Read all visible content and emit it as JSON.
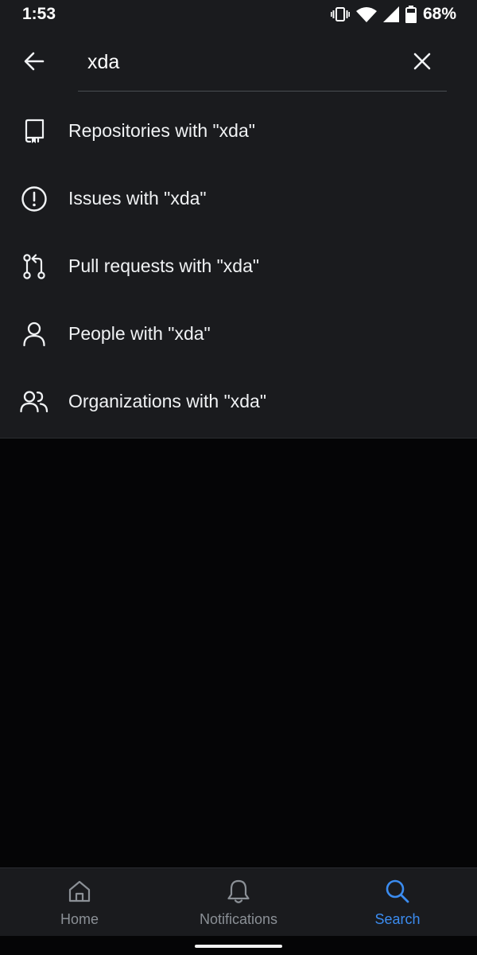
{
  "status_bar": {
    "time": "1:53",
    "battery_percent": "68%",
    "icons": [
      "vibrate-icon",
      "wifi-icon",
      "signal-icon",
      "battery-icon"
    ]
  },
  "search": {
    "query": "xda",
    "back_icon": "arrow-left-icon",
    "clear_icon": "close-icon"
  },
  "suggestions": [
    {
      "label": "Repositories with \"xda\"",
      "icon": "repo-icon"
    },
    {
      "label": "Issues with \"xda\"",
      "icon": "issue-opened-icon"
    },
    {
      "label": "Pull requests with \"xda\"",
      "icon": "git-pull-request-icon"
    },
    {
      "label": "People with \"xda\"",
      "icon": "person-icon"
    },
    {
      "label": "Organizations with \"xda\"",
      "icon": "people-icon"
    }
  ],
  "bottom_nav": {
    "items": [
      {
        "label": "Home",
        "icon": "home-icon",
        "active": false
      },
      {
        "label": "Notifications",
        "icon": "bell-icon",
        "active": false
      },
      {
        "label": "Search",
        "icon": "search-icon",
        "active": true
      }
    ]
  },
  "colors": {
    "background": "#050506",
    "surface": "#1a1b1e",
    "text_primary": "#f0f2f4",
    "text_muted": "#8b9096",
    "accent": "#3b8cf0"
  }
}
